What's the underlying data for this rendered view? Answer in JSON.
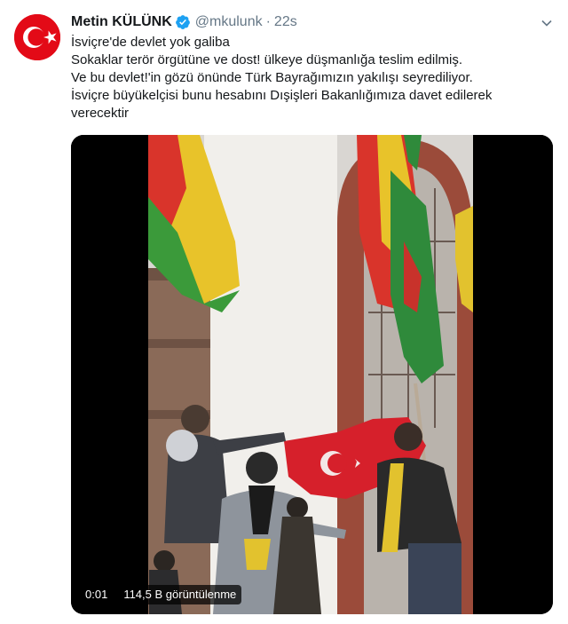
{
  "tweet": {
    "display_name": "Metin KÜLÜNK",
    "handle": "@mkulunk",
    "separator": "·",
    "timestamp": "22s",
    "lines": [
      "İsviçre'de devlet yok galiba",
      "Sokaklar terör örgütüne ve dost! ülkeye düşmanlığa teslim edilmiş.",
      "Ve bu devlet!'in gözü önünde Türk Bayrağımızın yakılışı seyrediliyor.",
      "İsviçre büyükelçisi bunu hesabını Dışişleri Bakanlığımıza davet edilerek",
      "verecektir"
    ]
  },
  "video": {
    "elapsed": "0:01",
    "views": "114,5 B görüntülenme"
  },
  "icons": {
    "verified": "verified-badge-icon",
    "caret": "chevron-down-icon",
    "avatar": "turkish-flag-avatar"
  },
  "colors": {
    "verified_blue": "#1da1f2",
    "text": "#14171a",
    "muted": "#657786",
    "flag_red": "#e30a17"
  }
}
